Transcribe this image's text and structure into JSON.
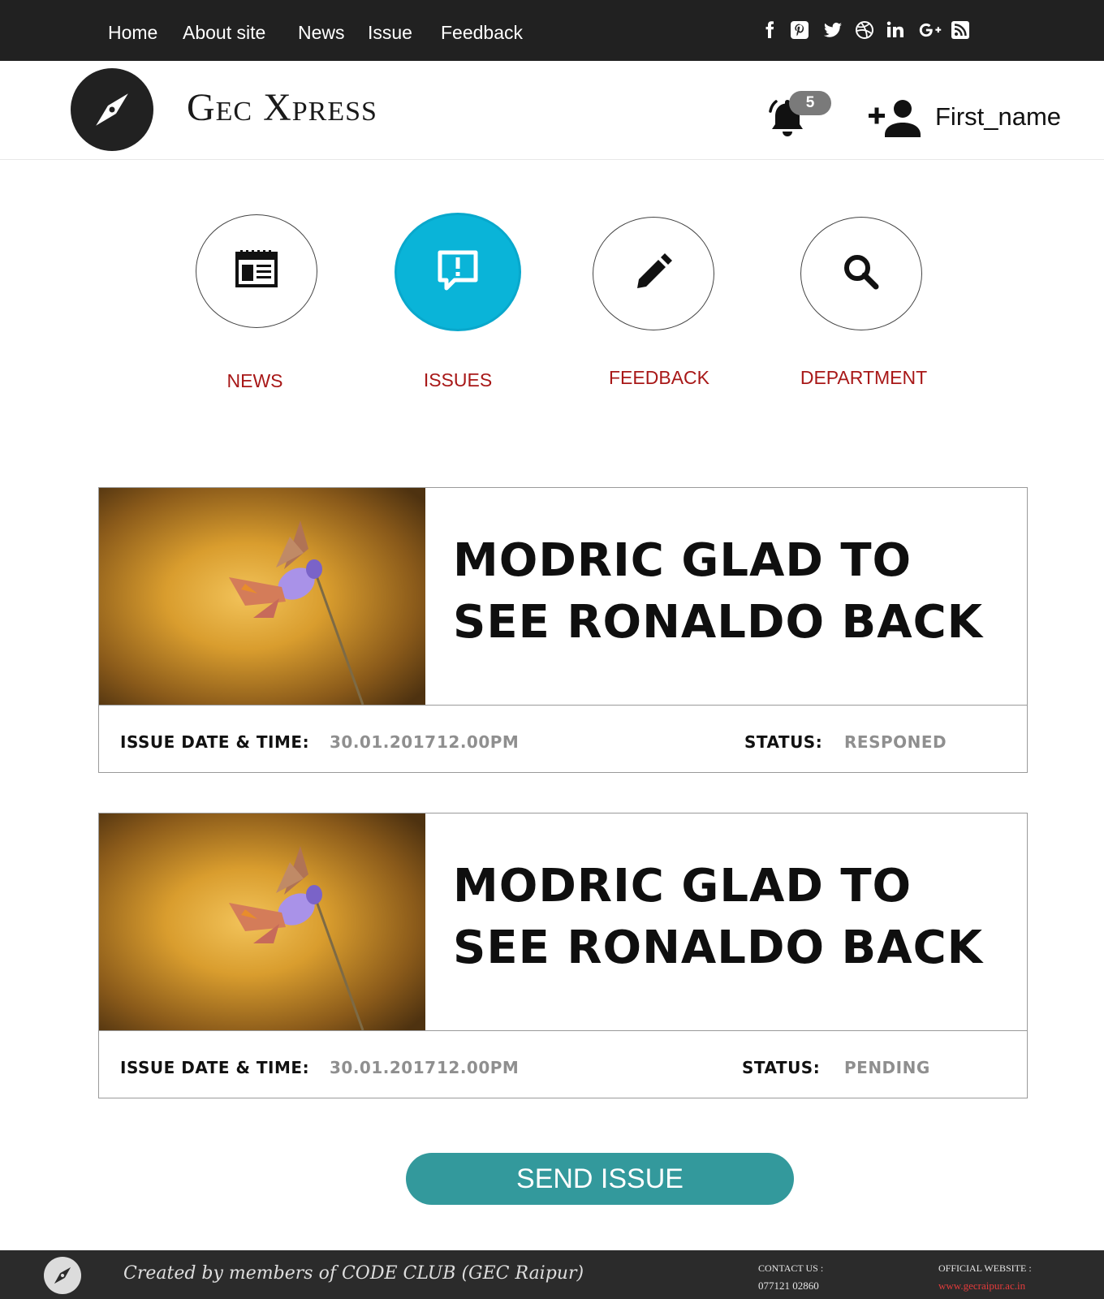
{
  "nav": {
    "items": [
      "Home",
      "About site",
      "News",
      "Issue",
      "Feedback"
    ]
  },
  "social_icons": [
    "facebook-icon",
    "pinterest-icon",
    "twitter-icon",
    "dribbble-icon",
    "linkedin-icon",
    "google-plus-icon",
    "rss-icon"
  ],
  "header": {
    "brand": "Gec Xpress",
    "notification_count": "5",
    "username": "First_name"
  },
  "categories": [
    {
      "label": "NEWS",
      "icon": "newspaper-icon",
      "active": false
    },
    {
      "label": "ISSUES",
      "icon": "feedback-exclamation-icon",
      "active": true
    },
    {
      "label": "FEEDBACK",
      "icon": "pencil-icon",
      "active": false
    },
    {
      "label": "DEPARTMENT",
      "icon": "search-icon",
      "active": false
    }
  ],
  "issues": [
    {
      "title": "MODRIC GLAD TO SEE RONALDO BACK",
      "date_label": "ISSUE DATE & TIME:",
      "date_value": "30.01.2017",
      "time_value": "12.00PM",
      "status_label": "STATUS:",
      "status_value": "RESPONED"
    },
    {
      "title": "MODRIC GLAD TO SEE RONALDO BACK",
      "date_label": "ISSUE DATE & TIME:",
      "date_value": "30.01.2017",
      "time_value": "12.00PM",
      "status_label": "STATUS:",
      "status_value": "PENDING"
    }
  ],
  "send_button": "SEND ISSUE",
  "footer": {
    "credit": "Created by members of CODE CLUB (GEC Raipur)",
    "contact_label": "CONTACT US :",
    "contact_value": "077121 02860",
    "website_label": "OFFICIAL WEBSITE :",
    "website_value": "www.gecraipur.ac.in"
  },
  "colors": {
    "topbar": "#212121",
    "accent_active": "#0ab4d8",
    "category_label": "#a81818",
    "send_button": "#33999c",
    "footer": "#2b2b2b",
    "link": "#e23b3b"
  }
}
